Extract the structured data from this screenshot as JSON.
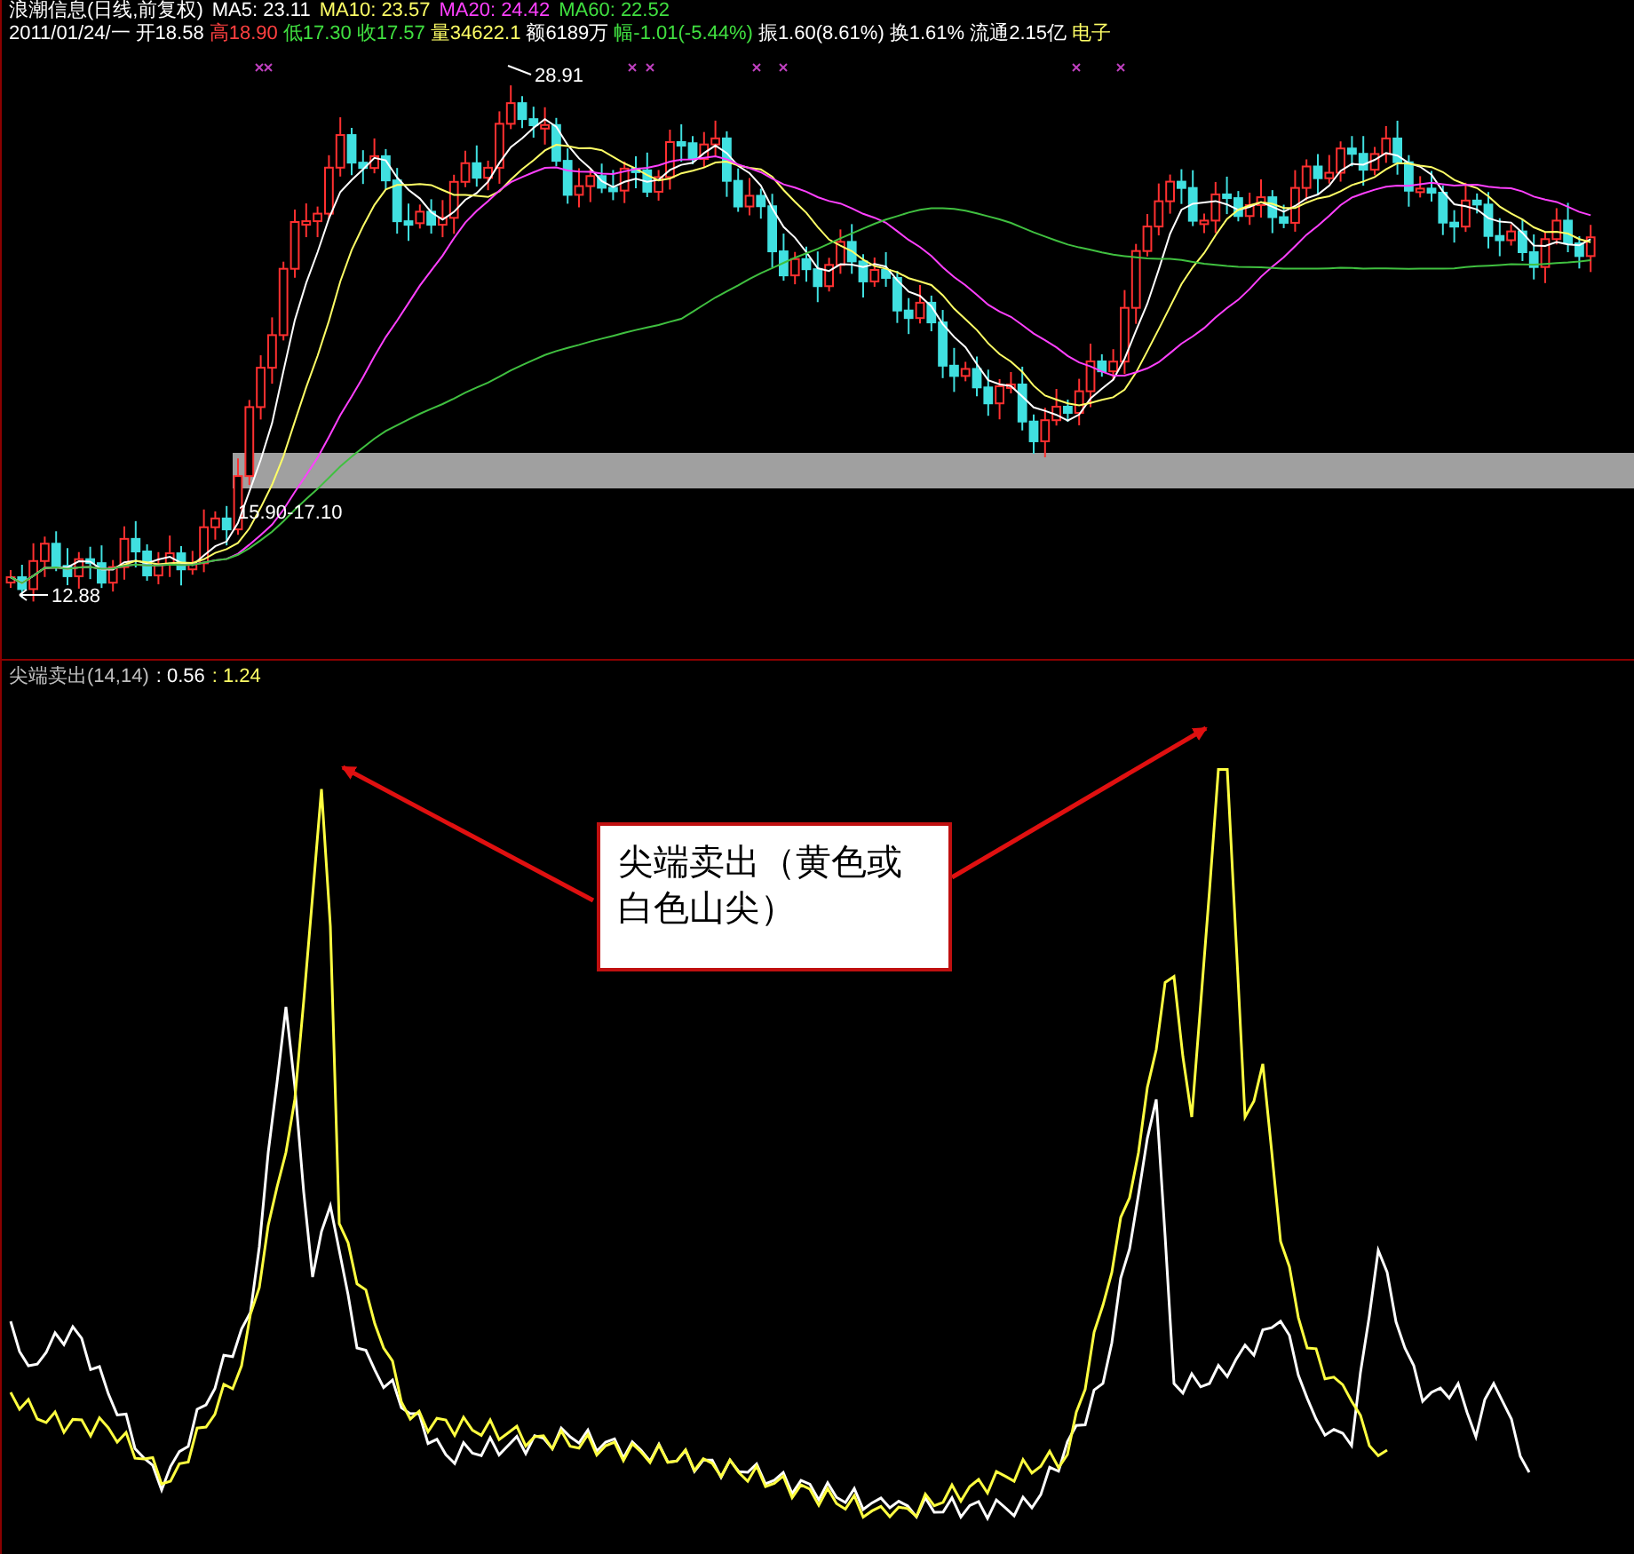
{
  "header_line_1": [
    {
      "text": "浪潮信息(日线,前复权)",
      "color": "#ffffff"
    },
    {
      "text": "MA5: 23.11",
      "color": "#ffffff"
    },
    {
      "text": "MA10: 23.57",
      "color": "#ffff66"
    },
    {
      "text": "MA20: 24.42",
      "color": "#ff40ff"
    },
    {
      "text": "MA60: 22.52",
      "color": "#40e040"
    }
  ],
  "header_line_2": [
    {
      "text": "2011/01/24/一",
      "color": "#ffffff"
    },
    {
      "text": "开18.58",
      "color": "#ffffff"
    },
    {
      "text": "高18.90",
      "color": "#ff4040"
    },
    {
      "text": "低17.30",
      "color": "#40e040"
    },
    {
      "text": "收17.57",
      "color": "#40e040"
    },
    {
      "text": "量34622.1",
      "color": "#ffff66"
    },
    {
      "text": "额6189万",
      "color": "#ffffff"
    },
    {
      "text": "幅-1.01(-5.44%)",
      "color": "#40e040"
    },
    {
      "text": "振1.60(8.61%)",
      "color": "#ffffff"
    },
    {
      "text": "换1.61%",
      "color": "#ffffff"
    },
    {
      "text": "流通2.15亿",
      "color": "#ffffff"
    },
    {
      "text": "电子",
      "color": "#ffff66"
    }
  ],
  "price_labels": {
    "high": "28.91",
    "low": "12.88",
    "band": "15.90-17.10"
  },
  "indicator": {
    "title": "尖端卖出(14,14)",
    "values": [
      {
        "text": ": 0.56",
        "color": "#ffffff"
      },
      {
        "text": ": 1.24",
        "color": "#ffff66"
      }
    ]
  },
  "callout": {
    "text": "尖端卖出（黄色或白色山尖）"
  }
}
